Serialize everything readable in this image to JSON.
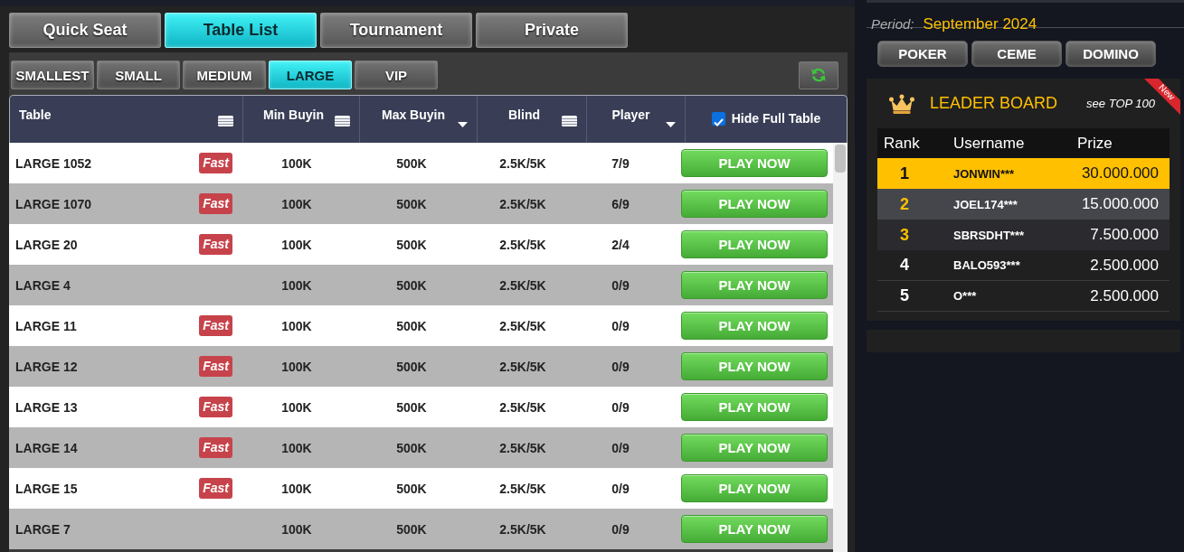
{
  "top_tabs": [
    {
      "label": "Quick Seat",
      "selected": false
    },
    {
      "label": "Table List",
      "selected": true
    },
    {
      "label": "Tournament",
      "selected": false
    },
    {
      "label": "Private",
      "selected": false
    }
  ],
  "size_filters": [
    {
      "label": "SMALLEST",
      "selected": false
    },
    {
      "label": "SMALL",
      "selected": false
    },
    {
      "label": "MEDIUM",
      "selected": false
    },
    {
      "label": "LARGE",
      "selected": true
    },
    {
      "label": "VIP",
      "selected": false
    }
  ],
  "table": {
    "columns": [
      {
        "label": "Table",
        "kind": "lines"
      },
      {
        "label": "Min Buyin",
        "kind": "lines"
      },
      {
        "label": "Max Buyin",
        "kind": "caret"
      },
      {
        "label": "Blind",
        "kind": "lines"
      },
      {
        "label": "Player",
        "kind": "caret"
      }
    ],
    "hide_full_table": {
      "label": "Hide Full Table",
      "checked": true
    },
    "rows": [
      {
        "name": "LARGE 1052",
        "badge": "Fast",
        "min_buyin": "100K",
        "max_buyin": "500K",
        "blind": "2.5K/5K",
        "players": "7/9",
        "action": "PLAY NOW"
      },
      {
        "name": "LARGE 1070",
        "badge": "Fast",
        "min_buyin": "100K",
        "max_buyin": "500K",
        "blind": "2.5K/5K",
        "players": "6/9",
        "action": "PLAY NOW"
      },
      {
        "name": "LARGE 20",
        "badge": "Fast",
        "min_buyin": "100K",
        "max_buyin": "500K",
        "blind": "2.5K/5K",
        "players": "2/4",
        "action": "PLAY NOW"
      },
      {
        "name": "LARGE 4",
        "min_buyin": "100K",
        "max_buyin": "500K",
        "blind": "2.5K/5K",
        "players": "0/9",
        "action": "PLAY NOW"
      },
      {
        "name": "LARGE 11",
        "badge": "Fast",
        "min_buyin": "100K",
        "max_buyin": "500K",
        "blind": "2.5K/5K",
        "players": "0/9",
        "action": "PLAY NOW"
      },
      {
        "name": "LARGE 12",
        "badge": "Fast",
        "min_buyin": "100K",
        "max_buyin": "500K",
        "blind": "2.5K/5K",
        "players": "0/9",
        "action": "PLAY NOW"
      },
      {
        "name": "LARGE 13",
        "badge": "Fast",
        "min_buyin": "100K",
        "max_buyin": "500K",
        "blind": "2.5K/5K",
        "players": "0/9",
        "action": "PLAY NOW"
      },
      {
        "name": "LARGE 14",
        "badge": "Fast",
        "min_buyin": "100K",
        "max_buyin": "500K",
        "blind": "2.5K/5K",
        "players": "0/9",
        "action": "PLAY NOW"
      },
      {
        "name": "LARGE 15",
        "badge": "Fast",
        "min_buyin": "100K",
        "max_buyin": "500K",
        "blind": "2.5K/5K",
        "players": "0/9",
        "action": "PLAY NOW"
      },
      {
        "name": "LARGE 7",
        "min_buyin": "100K",
        "max_buyin": "500K",
        "blind": "2.5K/5K",
        "players": "0/9",
        "action": "PLAY NOW"
      }
    ]
  },
  "period": {
    "label": "Period:",
    "value": "September 2024"
  },
  "game_tabs": [
    "POKER",
    "CEME",
    "DOMINO"
  ],
  "leaderboard": {
    "title": "LEADER BOARD",
    "link": "see TOP 100",
    "ribbon": "New",
    "columns": [
      "Rank",
      "Username",
      "Prize"
    ],
    "rows": [
      {
        "rank": "1",
        "username": "JONWIN***",
        "prize": "30.000.000"
      },
      {
        "rank": "2",
        "username": "JOEL174***",
        "prize": "15.000.000"
      },
      {
        "rank": "3",
        "username": "SBRSDHT***",
        "prize": "7.500.000"
      },
      {
        "rank": "4",
        "username": "BALO593***",
        "prize": "2.500.000"
      },
      {
        "rank": "5",
        "username": "O***",
        "prize": "2.500.000"
      }
    ]
  }
}
